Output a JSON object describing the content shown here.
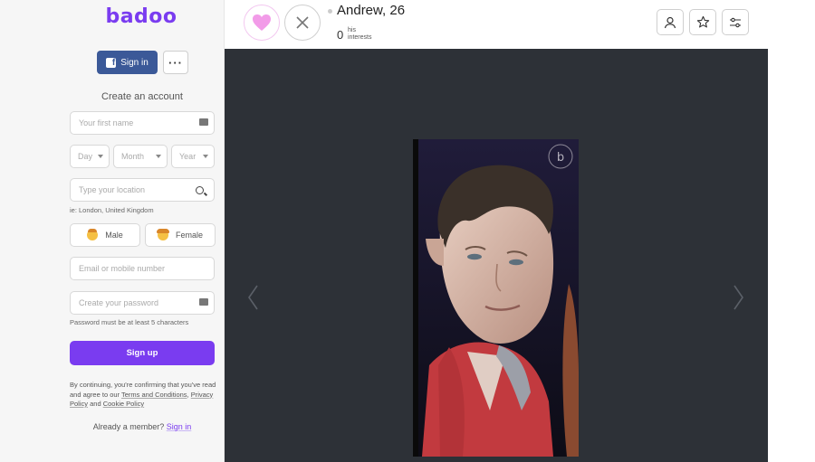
{
  "brand": {
    "logo_text": "badoo",
    "accent_color": "#7a3cf0"
  },
  "sidebar": {
    "facebook_button_label": "Sign in",
    "more_button_label": "···",
    "create_account_title": "Create an account",
    "first_name_placeholder": "Your first name",
    "day_placeholder": "Day",
    "month_placeholder": "Month",
    "year_placeholder": "Year",
    "location_placeholder": "Type your location",
    "location_hint": "ie: London, United Kingdom",
    "gender_male_label": "Male",
    "gender_female_label": "Female",
    "email_placeholder": "Email or mobile number",
    "password_placeholder": "Create your password",
    "password_hint": "Password must be at least 5 characters",
    "signup_label": "Sign up",
    "legal_text_1": "By continuing, you're confirming that you've read and agree to our ",
    "terms_link": "Terms and Conditions",
    "legal_comma": ", ",
    "privacy_link": "Privacy Policy",
    "legal_and": " and ",
    "cookie_link": "Cookie Policy",
    "already_member_text": "Already a member? ",
    "sign_in_link": "Sign in"
  },
  "profile": {
    "name_age": "Andrew, 26",
    "interest_count": "0",
    "interest_label_line1": "his",
    "interest_label_line2": "interests",
    "photo_watermark": "b"
  },
  "icons": {
    "like": "heart-icon",
    "pass": "close-icon",
    "profile": "user-icon",
    "favorites": "star-icon",
    "filters": "sliders-icon",
    "prev": "chevron-left-icon",
    "next": "chevron-right-icon"
  }
}
